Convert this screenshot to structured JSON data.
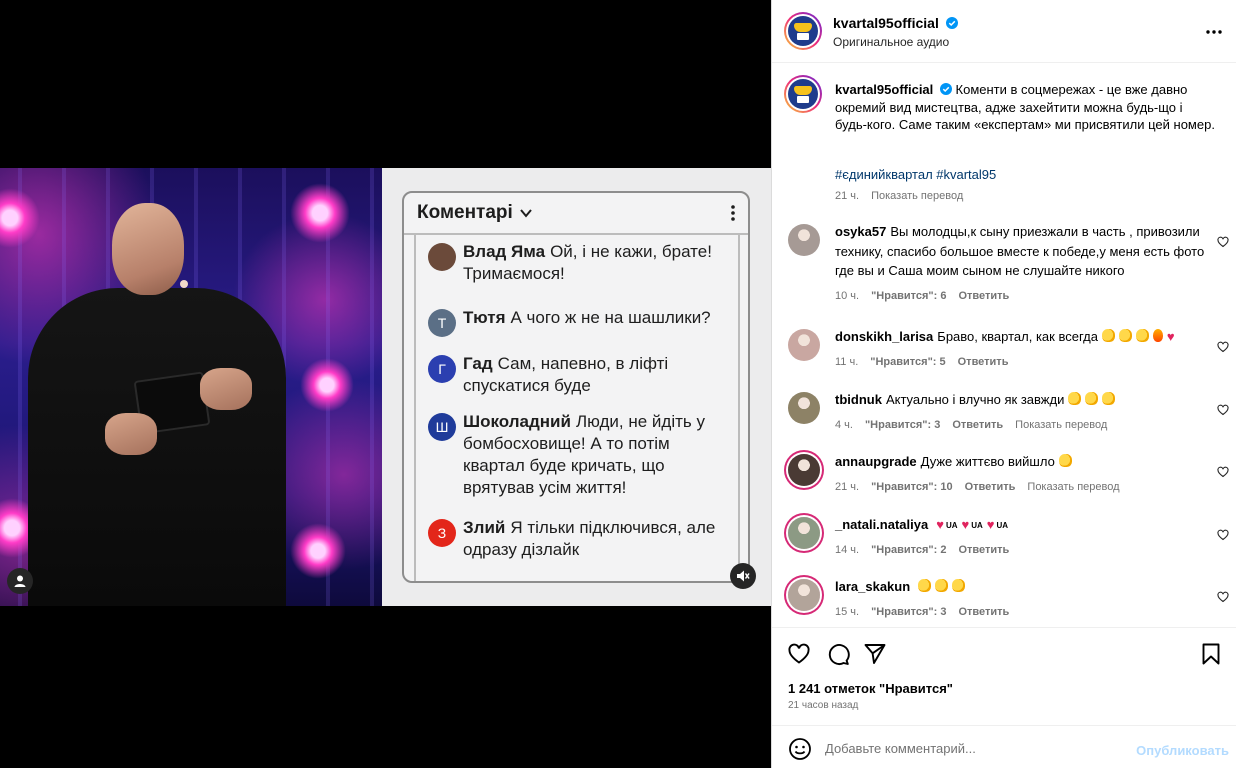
{
  "post": {
    "media": {
      "card_title": "Коментарі",
      "comments": [
        {
          "name": "Влад Яма",
          "text": "Ой, і не кажи, брате! Тримаємося!",
          "avatar_letter": "",
          "color": "#6b4a3a"
        },
        {
          "name": "Тютя",
          "text": "А чого ж не на шашлики?",
          "avatar_letter": "Т",
          "color": "#5b6f86"
        },
        {
          "name": "Гад",
          "text": "Сам, напевно, в ліфті спускатися буде",
          "avatar_letter": "Г",
          "color": "#2b3fb0"
        },
        {
          "name": "Шоколадний",
          "text": "Люди, не йдіть у бомбосховище! А то потім квартал буде кричать, що врятував усім життя!",
          "avatar_letter": "Ш",
          "color": "#1f3b9a"
        },
        {
          "name": "Злий",
          "text": "Я тільки підключився, але одразу дізлайк",
          "avatar_letter": "З",
          "color": "#e3261a"
        }
      ]
    },
    "header": {
      "username": "kvartal95official",
      "subtitle": "Оригинальное аудио",
      "logo_text": "95"
    },
    "caption": {
      "username": "kvartal95official",
      "text": "Коменти в соцмережах - це вже давно окремий вид мистецтва, адже захейтити можна будь-що і будь-кого. Саме таким «експертам» ми присвятили цей номер.",
      "hashtags": "#єдинийквартал #kvartal95",
      "time": "21 ч.",
      "translate": "Показать перевод"
    },
    "comments": [
      {
        "username": "osyka57",
        "text": "Вы молодцы,к сыну приезжали в часть , привозили технику, спасибо большое вместе к победе,у меня есть фото где вы и Саша моим сыном не слушайте никого",
        "time": "10 ч.",
        "likes": "\"Нравится\": 6",
        "reply": "Ответить",
        "translate": "",
        "avatar": "#a69a95"
      },
      {
        "username": "donskikh_larisa",
        "text": "Браво, квартал, как всегда",
        "time": "11 ч.",
        "likes": "\"Нравится\": 5",
        "reply": "Ответить",
        "translate": "",
        "avatar": "#c9a7a1"
      },
      {
        "username": "tbidnuk",
        "text": "Актуально і влучно як завжди",
        "time": "4 ч.",
        "likes": "\"Нравится\": 3",
        "reply": "Ответить",
        "translate": "Показать перевод",
        "avatar": "#8d8266"
      },
      {
        "username": "annaupgrade",
        "text": "Дуже життєво вийшло",
        "time": "21 ч.",
        "likes": "\"Нравится\": 10",
        "reply": "Ответить",
        "translate": "Показать перевод",
        "avatar": "#4a3a34"
      },
      {
        "username": "_natali.nataliya",
        "text": "",
        "time": "14 ч.",
        "likes": "\"Нравится\": 2",
        "reply": "Ответить",
        "translate": "",
        "avatar": "#8c9a84"
      },
      {
        "username": "lara_skakun",
        "text": "",
        "time": "15 ч.",
        "likes": "\"Нравится\": 3",
        "reply": "Ответить",
        "translate": "",
        "avatar": "#b2a49a"
      }
    ],
    "ua_label": "UA",
    "likes_count": "1 241 отметок \"Нравится\"",
    "posted_ago": "21 часов назад",
    "composer": {
      "placeholder": "Добавьте комментарий...",
      "publish": "Опубликовать"
    },
    "colors": {
      "link": "#00376b",
      "muted": "#737373",
      "publish_disabled": "#b3dbff",
      "verified": "#0095f6"
    }
  }
}
